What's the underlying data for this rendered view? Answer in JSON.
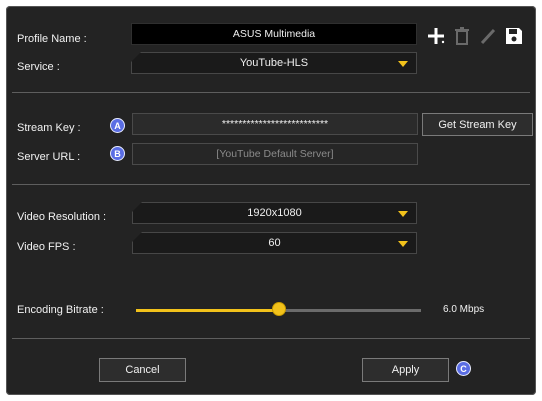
{
  "profile": {
    "label": "Profile Name :",
    "value": "ASUS Multimedia"
  },
  "toolbar": {
    "add_icon": "plus-icon",
    "delete_icon": "trash-icon",
    "edit_icon": "pencil-icon",
    "save_icon": "floppy-disk-icon"
  },
  "service": {
    "label": "Service :",
    "value": "YouTube-HLS"
  },
  "stream_key": {
    "label": "Stream Key :",
    "badge": "A",
    "value": "**************************",
    "button": "Get Stream Key"
  },
  "server_url": {
    "label": "Server URL :",
    "badge": "B",
    "placeholder": "[YouTube Default Server]"
  },
  "video_resolution": {
    "label": "Video Resolution :",
    "value": "1920x1080"
  },
  "video_fps": {
    "label": "Video FPS :",
    "value": "60"
  },
  "bitrate": {
    "label": "Encoding Bitrate :",
    "value_text": "6.0 Mbps",
    "level": 0.5
  },
  "footer": {
    "cancel": "Cancel",
    "apply": "Apply",
    "badge": "C"
  },
  "colors": {
    "panel": "#232323",
    "accent": "#f2c21b",
    "badge": "#5a6de4"
  }
}
